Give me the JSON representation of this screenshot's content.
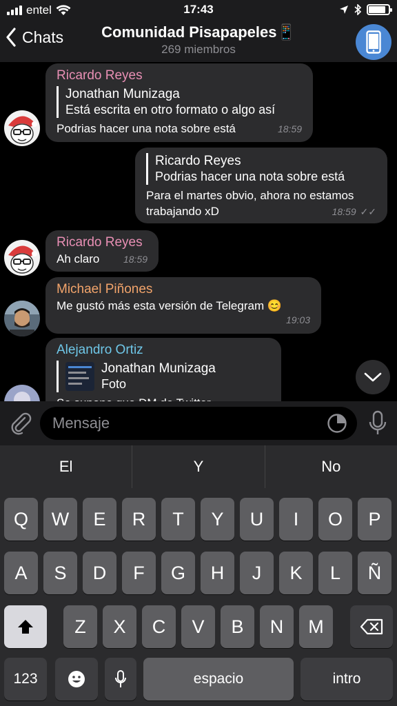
{
  "status_bar": {
    "carrier": "entel",
    "time": "17:43",
    "battery_level": 0.85
  },
  "nav": {
    "back_label": "Chats",
    "title": "Comunidad Pisapapeles📱",
    "subtitle": "269 miembros"
  },
  "messages": [
    {
      "sender": "Ricardo Reyes",
      "reply_name": "Jonathan Munizaga",
      "reply_text": "Está escrita en otro formato o algo así",
      "text": "Podrias hacer una nota sobre está",
      "time": "18:59"
    },
    {
      "reply_name": "Ricardo Reyes",
      "reply_text": "Podrias hacer una nota sobre está",
      "text_line1": "Para el martes obvio, ahora no estamos",
      "text_line2": "trabajando xD",
      "time": "18:59",
      "read_mark": "✓✓"
    },
    {
      "sender": "Ricardo Reyes",
      "text": "Ah claro",
      "time": "18:59"
    },
    {
      "sender": "Michael Piñones",
      "text": "Me gustó más esta versión de Telegram 😊",
      "time": "19:03"
    },
    {
      "sender": "Alejandro Ortiz",
      "reply_name": "Jonathan Munizaga",
      "reply_text": "Foto",
      "text": "Se supone que DM de Twitter"
    }
  ],
  "composer": {
    "placeholder": "Mensaje"
  },
  "keyboard": {
    "suggestions": [
      "El",
      "Y",
      "No"
    ],
    "row1": [
      "Q",
      "W",
      "E",
      "R",
      "T",
      "Y",
      "U",
      "I",
      "O",
      "P"
    ],
    "row2": [
      "A",
      "S",
      "D",
      "F",
      "G",
      "H",
      "J",
      "K",
      "L",
      "Ñ"
    ],
    "row3": [
      "Z",
      "X",
      "C",
      "V",
      "B",
      "N",
      "M"
    ],
    "numbers_label": "123",
    "space_label": "espacio",
    "return_label": "intro"
  },
  "colors": {
    "ricardo": "#e88fb4",
    "michael": "#f2a46b",
    "alejandro": "#6fc7e8",
    "accent_blue": "#4a87d4"
  },
  "icons": [
    "back-chevron-icon",
    "phone-icon",
    "attach-icon",
    "sticker-icon",
    "microphone-icon",
    "chevron-down-icon",
    "shift-icon",
    "backspace-icon",
    "emoji-icon"
  ]
}
